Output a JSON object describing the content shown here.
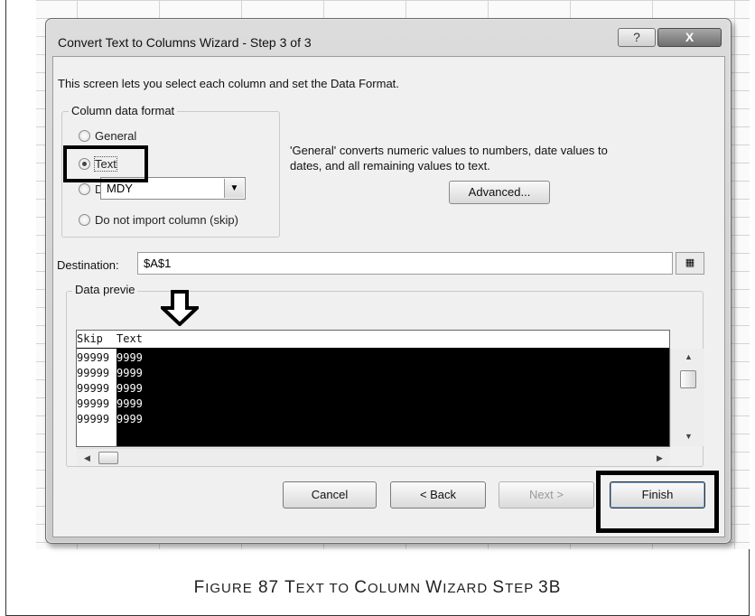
{
  "dialog": {
    "title": "Convert Text to Columns Wizard - Step 3 of 3",
    "help_label": "?",
    "close_label": "X",
    "description": "This screen lets you select each column and set the Data Format."
  },
  "column_format": {
    "group_label": "Column data format",
    "options": [
      {
        "label": "General",
        "selected": false
      },
      {
        "label": "Text",
        "selected": true
      },
      {
        "label": "Date:",
        "selected": false
      },
      {
        "label": "Do not import column (skip)",
        "selected": false
      }
    ],
    "date_value": "MDY",
    "info_line1": "'General' converts numeric values to numbers, date values to",
    "info_line2": "dates, and all remaining values to text.",
    "advanced_label": "Advanced..."
  },
  "destination": {
    "label": "Destination:",
    "value": "$A$1"
  },
  "preview": {
    "label": "Data previe",
    "columns": [
      "Skip",
      "Text"
    ],
    "rows": [
      [
        "99999",
        "9999"
      ],
      [
        "99999",
        "9999"
      ],
      [
        "99999",
        "9999"
      ],
      [
        "99999",
        "9999"
      ],
      [
        "99999",
        "9999"
      ]
    ]
  },
  "buttons": {
    "cancel": "Cancel",
    "back": "< Back",
    "next": "Next >",
    "finish": "Finish"
  },
  "caption": {
    "figure": "F",
    "figure_rest": "IGURE",
    "number": " 87 ",
    "t": "T",
    "t_rest": "EXT TO ",
    "c": "C",
    "c_rest": "OLUMN ",
    "w": "W",
    "w_rest": "IZARD ",
    "s": "S",
    "s_rest": "TEP ",
    "step": "3B"
  },
  "colors": {
    "highlight": "#000000",
    "selected_column": "#000000"
  }
}
